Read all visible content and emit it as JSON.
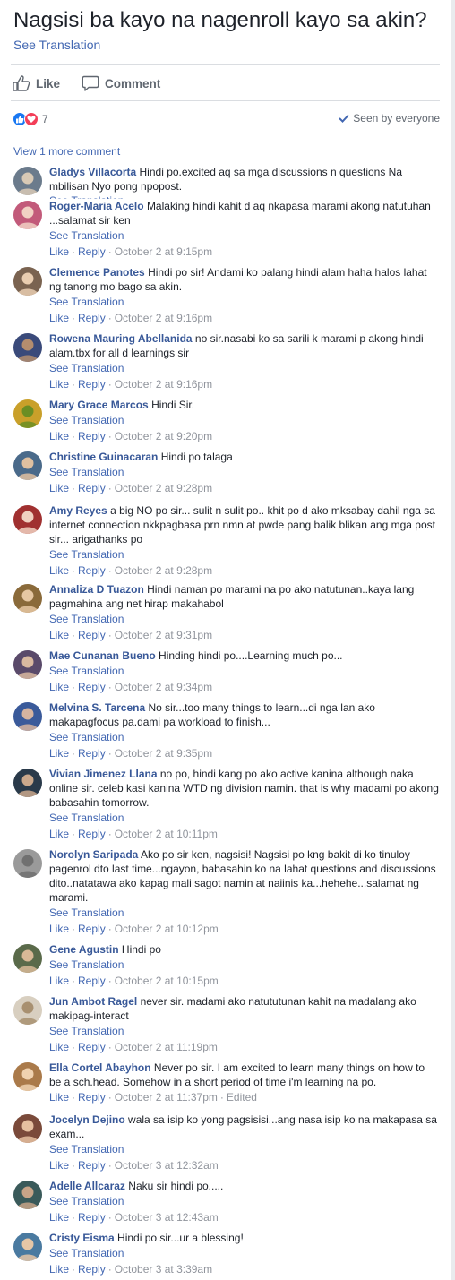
{
  "post": {
    "title": "Nagsisi ba kayo na nagenroll kayo sa akin?",
    "see_translation": "See Translation",
    "like_label": "Like",
    "comment_label": "Comment",
    "reaction_count": "7",
    "seen_label": "Seen by everyone",
    "view_more": "View 1 more comment"
  },
  "labels": {
    "like": "Like",
    "reply": "Reply",
    "see_translation": "See Translation",
    "edited": "Edited"
  },
  "colors": {
    "link": "#4267b2",
    "name": "#385898",
    "like_blue": "#1877f2",
    "love_red": "#f33e58"
  },
  "comments": [
    {
      "name": "Gladys Villacorta",
      "text": "Hindi po.excited aq sa mga discussions n questions Na mbilisan Nyo pong npopost.",
      "time": "",
      "edited": ""
    },
    {
      "name": "Roger-Maria Acelo",
      "text": "Malaking hindi kahit d aq nkapasa marami akong natutuhan ...salamat sir ken",
      "time": "October 2 at 9:15pm",
      "edited": ""
    },
    {
      "name": "Clemence Panotes",
      "text": "Hindi po sir! Andami ko palang hindi alam haha halos lahat ng tanong mo bago sa akin.",
      "time": "October 2 at 9:16pm",
      "edited": ""
    },
    {
      "name": "Rowena Mauring Abellanida",
      "text": "no sir.nasabi ko sa sarili k marami p akong hindi alam.tbx for all d learnings sir",
      "time": "October 2 at 9:16pm",
      "edited": ""
    },
    {
      "name": "Mary Grace Marcos",
      "text": "Hindi Sir.",
      "time": "October 2 at 9:20pm",
      "edited": ""
    },
    {
      "name": "Christine Guinacaran",
      "text": "Hindi po talaga",
      "time": "October 2 at 9:28pm",
      "edited": ""
    },
    {
      "name": "Amy Reyes",
      "text": "a big NO po sir... sulit n sulit po.. khit po d ako mksabay dahil nga sa internet connection nkkpagbasa prn nmn at pwde pang balik blikan ang mga post sir... arigathanks po",
      "time": "October 2 at 9:28pm",
      "edited": ""
    },
    {
      "name": "Annaliza D Tuazon",
      "text": "Hindi naman po marami na po ako natutunan..kaya lang pagmahina ang net hirap makahabol",
      "time": "October 2 at 9:31pm",
      "edited": ""
    },
    {
      "name": "Mae Cunanan Bueno",
      "text": "Hinding hindi po....Learning much po...",
      "time": "October 2 at 9:34pm",
      "edited": ""
    },
    {
      "name": "Melvina S. Tarcena",
      "text": "No sir...too many things to learn...di nga lan ako makapagfocus pa.dami pa workload to finish...",
      "time": "October 2 at 9:35pm",
      "edited": ""
    },
    {
      "name": "Vivian Jimenez Llana",
      "text": "no po, hindi kang po ako active kanina although naka online sir. celeb kasi kanina WTD ng division namin. that is why madami po akong babasahin tomorrow.",
      "time": "October 2 at 10:11pm",
      "edited": ""
    },
    {
      "name": "Norolyn Saripada",
      "text": "Ako po sir ken, nagsisi! Nagsisi po kng bakit di ko tinuloy pagenrol dto last time...ngayon, babasahin ko na lahat questions and discussions dito..natatawa ako kapag mali sagot namin at naiinis ka...hehehe...salamat ng marami.",
      "time": "October 2 at 10:12pm",
      "edited": ""
    },
    {
      "name": "Gene Agustin",
      "text": "Hindi po",
      "time": "October 2 at 10:15pm",
      "edited": ""
    },
    {
      "name": "Jun Ambot Ragel",
      "text": "never sir. madami ako natututunan kahit na madalang ako makipag-interact",
      "time": "October 2 at 11:19pm",
      "edited": ""
    },
    {
      "name": "Ella Cortel Abayhon",
      "text": "Never po sir. I am excited to learn many things on how to be a sch.head. Somehow in a short period of time i'm learning na po.",
      "time": "October 2 at 11:37pm",
      "edited": "Edited"
    },
    {
      "name": "Jocelyn Dejino",
      "text": "wala sa isip ko yong pagsisisi...ang nasa isip ko na makapasa sa exam...",
      "time": "October 3 at 12:32am",
      "edited": ""
    },
    {
      "name": "Adelle Allcaraz",
      "text": "Naku sir hindi po.....",
      "time": "October 3 at 12:43am",
      "edited": ""
    },
    {
      "name": "Cristy Eisma",
      "text": "Hindi po sir...ur a blessing!",
      "time": "October 3 at 3:39am",
      "edited": ""
    }
  ]
}
